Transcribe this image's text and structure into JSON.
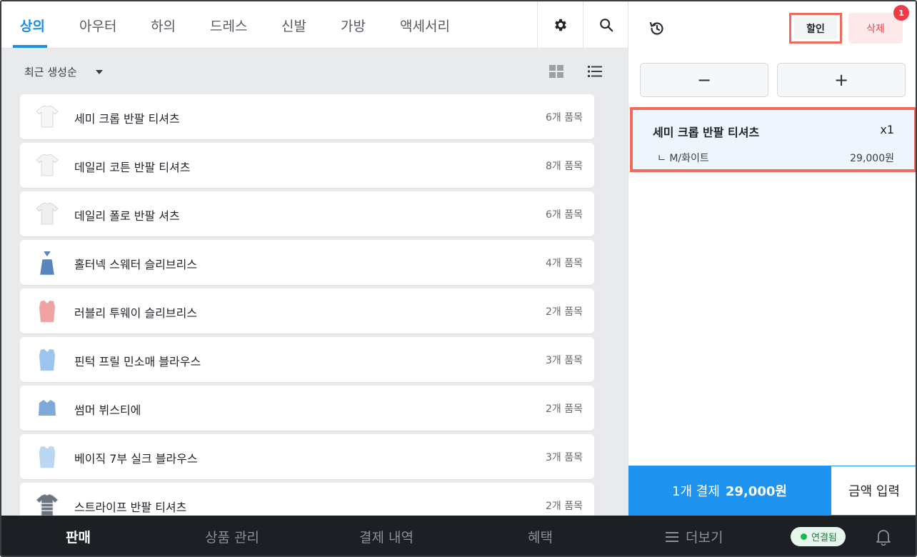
{
  "categories": [
    {
      "label": "상의",
      "active": true
    },
    {
      "label": "아우터",
      "active": false
    },
    {
      "label": "하의",
      "active": false
    },
    {
      "label": "드레스",
      "active": false
    },
    {
      "label": "신발",
      "active": false
    },
    {
      "label": "가방",
      "active": false
    },
    {
      "label": "액세서리",
      "active": false
    }
  ],
  "header_icons": [
    "gear-icon",
    "search-icon"
  ],
  "sort": {
    "label": "최근 생성순"
  },
  "view_toggle": [
    "grid-view-icon",
    "list-view-icon"
  ],
  "products": [
    {
      "name": "세미 크롭 반팔 티셔츠",
      "count": "6개 품목",
      "thumb_color": "#f7f7f7"
    },
    {
      "name": "데일리 코튼 반팔 티셔츠",
      "count": "8개 품목",
      "thumb_color": "#f4f4f4"
    },
    {
      "name": "데일리 폴로 반팔 셔츠",
      "count": "6개 품목",
      "thumb_color": "#efefef"
    },
    {
      "name": "홀터넥 스웨터 슬리브리스",
      "count": "4개 품목",
      "thumb_color": "#5a86c0"
    },
    {
      "name": "러블리 투웨이 슬리브리스",
      "count": "2개 품목",
      "thumb_color": "#f2a2a2"
    },
    {
      "name": "핀턱 프릴 민소매 블라우스",
      "count": "3개 품목",
      "thumb_color": "#9cc4ef"
    },
    {
      "name": "썸머 뷔스티에",
      "count": "2개 품목",
      "thumb_color": "#7fa9d6"
    },
    {
      "name": "베이직 7부 실크 블라우스",
      "count": "3개 품목",
      "thumb_color": "#b9d6f2"
    },
    {
      "name": "스트라이프 반팔 티셔츠",
      "count": "2개 품목",
      "thumb_color": "#6c7480"
    }
  ],
  "cart": {
    "discount_label": "할인",
    "delete_label": "삭제",
    "badge": "1",
    "minus": "−",
    "plus": "+",
    "item": {
      "name": "세미 크롭 반팔 티셔츠",
      "qty": "x1",
      "option": "ㄴ M/화이트",
      "price": "29,000원"
    },
    "pay_count": "1개 결제",
    "pay_amount": "29,000원",
    "amount_input": "금액 입력"
  },
  "bottom_nav": [
    {
      "label": "판매",
      "active": true
    },
    {
      "label": "상품 관리",
      "active": false
    },
    {
      "label": "결제 내역",
      "active": false
    },
    {
      "label": "혜택",
      "active": false
    },
    {
      "label": "더보기",
      "active": false
    }
  ],
  "status": {
    "connected": "연결됨"
  },
  "colors": {
    "accent": "#1a8fe3",
    "pay": "#1e93f0",
    "highlight": "#ee6a5a",
    "delete": "#e5484d",
    "nav_bg": "#1c1f24"
  }
}
